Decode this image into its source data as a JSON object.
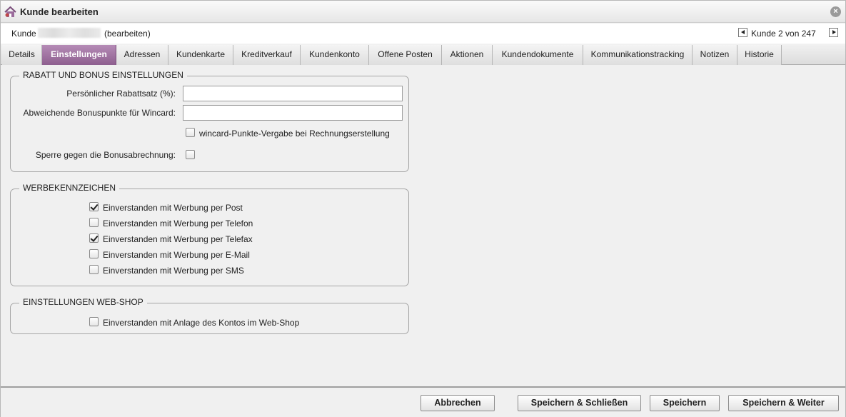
{
  "window": {
    "title": "Kunde bearbeiten",
    "close_icon": "close-icon"
  },
  "record": {
    "label": "Kunde",
    "suffix": "(bearbeiten)",
    "pager_text": "Kunde 2 von 247"
  },
  "tabs": [
    {
      "label": "Details",
      "active": false
    },
    {
      "label": "Einstellungen",
      "active": true
    },
    {
      "label": "Adressen",
      "active": false
    },
    {
      "label": "Kundenkarte",
      "active": false
    },
    {
      "label": "Kreditverkauf",
      "active": false
    },
    {
      "label": "Kundenkonto",
      "active": false
    },
    {
      "label": "Offene Posten",
      "active": false
    },
    {
      "label": "Aktionen",
      "active": false
    },
    {
      "label": "Kundendokumente",
      "active": false
    },
    {
      "label": "Kommunikationstracking",
      "active": false
    },
    {
      "label": "Notizen",
      "active": false
    },
    {
      "label": "Historie",
      "active": false
    }
  ],
  "rabatt": {
    "legend": "RABATT UND BONUS EINSTELLUNGEN",
    "rabattsatz_label": "Persönlicher Rabattsatz (%):",
    "rabattsatz_value": "",
    "bonuspunkte_label": "Abweichende Bonuspunkte für Wincard:",
    "bonuspunkte_value": "",
    "wincard_label": "wincard-Punkte-Vergabe bei Rechnungserstellung",
    "wincard_checked": false,
    "sperre_label": "Sperre gegen die Bonusabrechnung:",
    "sperre_checked": false
  },
  "werbung": {
    "legend": "WERBEKENNZEICHEN",
    "items": [
      {
        "label": "Einverstanden mit Werbung per Post",
        "checked": true
      },
      {
        "label": "Einverstanden mit Werbung per Telefon",
        "checked": false
      },
      {
        "label": "Einverstanden mit Werbung per Telefax",
        "checked": true
      },
      {
        "label": "Einverstanden mit Werbung per E-Mail",
        "checked": false
      },
      {
        "label": "Einverstanden mit Werbung per SMS",
        "checked": false
      }
    ]
  },
  "webshop": {
    "legend": "EINSTELLUNGEN WEB-SHOP",
    "item": {
      "label": "Einverstanden mit Anlage des Kontos im Web-Shop",
      "checked": false
    }
  },
  "footer": {
    "cancel": "Abbrechen",
    "save_close": "Speichern & Schließen",
    "save": "Speichern",
    "save_next": "Speichern & Weiter"
  },
  "colors": {
    "active_tab": "#9b6b9c"
  }
}
